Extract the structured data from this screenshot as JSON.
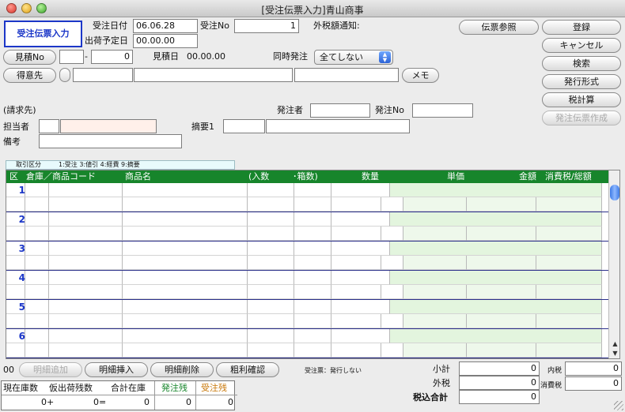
{
  "window": {
    "title": "[受注伝票入力]青山商事"
  },
  "mode_badge": "受注伝票入力",
  "header": {
    "order_date_label": "受注日付",
    "order_date": "06.06.28",
    "order_no_label": "受注No",
    "order_no": "1",
    "tax_notice_label": "外税額通知:",
    "ship_date_label": "出荷予定日",
    "ship_date": "00.00.00",
    "estimate_btn": "見積No",
    "estimate_prefix": "",
    "estimate_no": "0",
    "estimate_date_label": "見積日",
    "estimate_date": "00.00.00",
    "simul_label": "同時発注",
    "simul_value": "全てしない",
    "customer_btn": "得意先",
    "memo_btn": "メモ",
    "billing_label": "(請求先)",
    "orderer_label": "発注者",
    "po_no_label": "発注No",
    "person_label": "担当者",
    "summary_label": "摘要1",
    "remarks_label": "備考"
  },
  "buttons": {
    "slip_ref": "伝票参照",
    "register": "登録",
    "cancel": "キャンセル",
    "search": "検索",
    "format": "発行形式",
    "tax_calc": "税計算",
    "po_create": "発注伝票作成"
  },
  "category_bar": {
    "label": "取引区分",
    "codes": "1:受注 3:値引 4:経費 9:摘要"
  },
  "grid": {
    "headers": [
      "区",
      "倉庫／商品コード",
      "商品名",
      "(入数",
      "･箱数)",
      "数量",
      "単価",
      "金額",
      "消費税/総額"
    ],
    "row_numbers": [
      "1",
      "2",
      "3",
      "4",
      "5",
      "6"
    ]
  },
  "footer": {
    "row_count": "00",
    "add_detail": "明細追加",
    "insert_detail": "明細挿入",
    "delete_detail": "明細削除",
    "profit_check": "粗利確認",
    "status_note": "受注票：発行しない",
    "subtotal_label": "小計",
    "subtotal": "0",
    "outer_tax_label": "外税",
    "outer_tax": "0",
    "total_label": "税込合計",
    "total": "0",
    "inner_tax_label": "内税",
    "inner_tax": "0",
    "consumption_tax_label": "消費税",
    "consumption_tax": "0"
  },
  "stock": {
    "headers": [
      "現在庫数",
      "仮出荷残数",
      "合計在庫",
      "発注残",
      "受注残"
    ],
    "values": [
      "0+",
      "0=",
      "0",
      "0",
      "0"
    ],
    "colors": {
      "order_po": "#17852b",
      "order_so": "#c8780a"
    }
  }
}
